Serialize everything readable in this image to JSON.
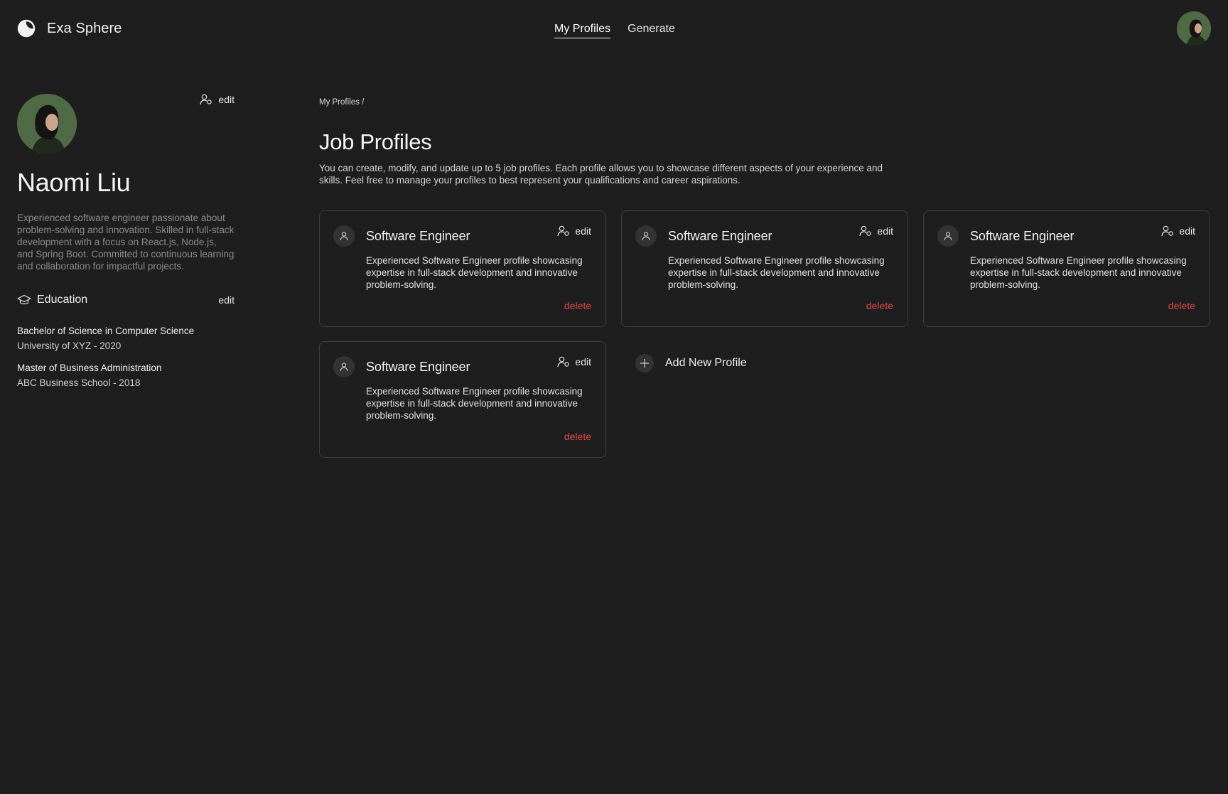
{
  "brand": {
    "name": "Exa Sphere",
    "logo_icon": "crescent-logo-icon"
  },
  "nav": {
    "items": [
      {
        "label": "My Profiles",
        "active": true
      },
      {
        "label": "Generate",
        "active": false
      }
    ]
  },
  "user": {
    "name": "Naomi Liu",
    "bio": "Experienced software engineer passionate about problem-solving and innovation. Skilled in full-stack development with a focus on React.js, Node.js, and Spring Boot. Committed to continuous learning and collaboration for impactful projects.",
    "edit_label": "edit",
    "avatar_icon": "user-photo-avatar"
  },
  "education": {
    "title": "Education",
    "edit_label": "edit",
    "icon": "graduation-cap-icon",
    "items": [
      {
        "degree": "Bachelor of Science in Computer Science",
        "school": "University of XYZ - 2020"
      },
      {
        "degree": "Master of Business Administration",
        "school": "ABC Business School - 2018"
      }
    ]
  },
  "main": {
    "breadcrumb": "My Profiles /",
    "title": "Job Profiles",
    "description": "You can create, modify, and update up to 5 job profiles. Each profile allows you to showcase different aspects of your experience and skills. Feel free to manage your profiles to best represent your qualifications and career aspirations.",
    "add_label": "Add New Profile"
  },
  "profiles": [
    {
      "title": "Software Engineer",
      "description": "Experienced Software Engineer profile showcasing expertise in full-stack development and innovative problem-solving.",
      "edit_label": "edit",
      "delete_label": "delete"
    },
    {
      "title": "Software Engineer",
      "description": "Experienced Software Engineer profile showcasing expertise in full-stack development and innovative problem-solving.",
      "edit_label": "edit",
      "delete_label": "delete"
    },
    {
      "title": "Software Engineer",
      "description": "Experienced Software Engineer profile showcasing expertise in full-stack development and innovative problem-solving.",
      "edit_label": "edit",
      "delete_label": "delete"
    },
    {
      "title": "Software Engineer",
      "description": "Experienced Software Engineer profile showcasing expertise in full-stack development and innovative problem-solving.",
      "edit_label": "edit",
      "delete_label": "delete"
    }
  ],
  "colors": {
    "background": "#1e1e1e",
    "card_border": "#3d3d3d",
    "delete": "#e04848",
    "avatar_bg": "#4f6b45",
    "muted_text": "#8b8b8b"
  }
}
